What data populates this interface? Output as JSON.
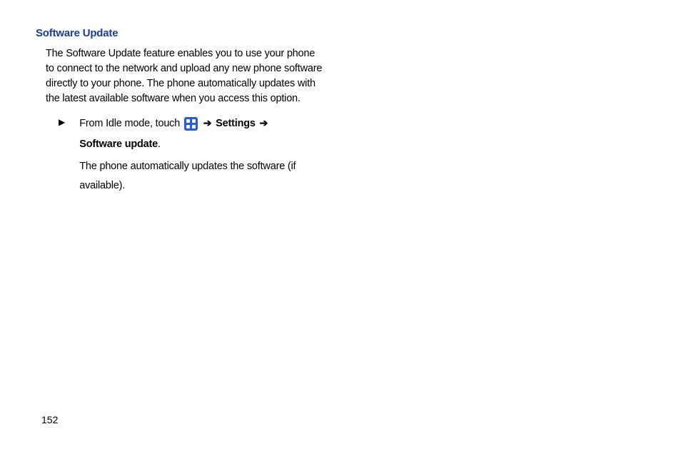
{
  "heading": "Software Update",
  "intro": "The Software Update feature enables you to use your phone to connect to the network and upload any new phone software directly to your phone. The phone automatically updates with the latest available software when you access this option.",
  "step": {
    "bullet": "▶",
    "prefix": "From Idle mode, touch ",
    "arrow1": "➔",
    "settings": "Settings",
    "arrow2": "➔",
    "software_update": "Software update",
    "period": ".",
    "result": "The phone automatically updates the software (if available)."
  },
  "page_number": "152"
}
